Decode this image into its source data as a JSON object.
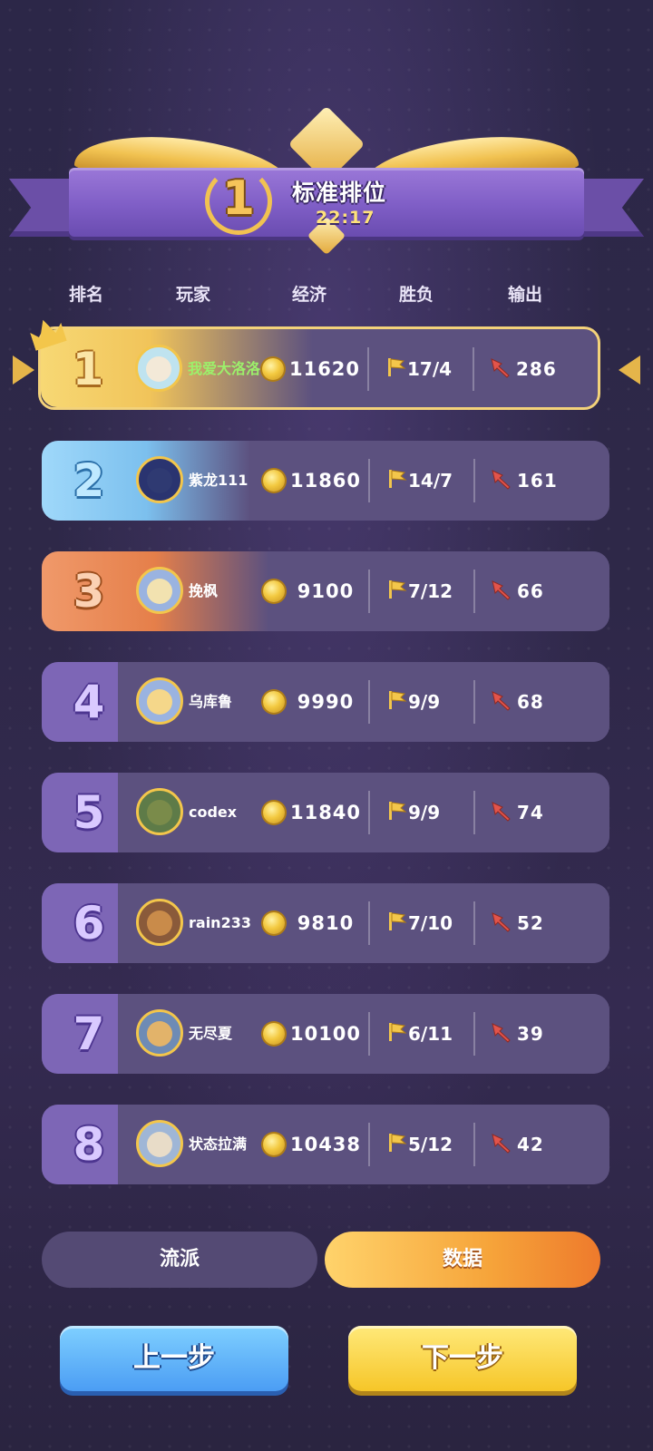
{
  "header": {
    "rank": "1",
    "title": "标准排位",
    "time": "22:17"
  },
  "columns": [
    "排名",
    "玩家",
    "经济",
    "胜负",
    "输出"
  ],
  "players": [
    {
      "rank": "1",
      "name": "我爱大洛洛",
      "gold": "11620",
      "win_loss": "17/4",
      "damage": "286"
    },
    {
      "rank": "2",
      "name": "紫龙111",
      "gold": "11860",
      "win_loss": "14/7",
      "damage": "161"
    },
    {
      "rank": "3",
      "name": "挽枫",
      "gold": "9100",
      "win_loss": "7/12",
      "damage": "66"
    },
    {
      "rank": "4",
      "name": "乌库鲁",
      "gold": "9990",
      "win_loss": "9/9",
      "damage": "68"
    },
    {
      "rank": "5",
      "name": "codex",
      "gold": "11840",
      "win_loss": "9/9",
      "damage": "74"
    },
    {
      "rank": "6",
      "name": "rain233",
      "gold": "9810",
      "win_loss": "7/10",
      "damage": "52"
    },
    {
      "rank": "7",
      "name": "无尽夏",
      "gold": "10100",
      "win_loss": "6/11",
      "damage": "39"
    },
    {
      "rank": "8",
      "name": "状态拉满",
      "gold": "10438",
      "win_loss": "5/12",
      "damage": "42"
    }
  ],
  "tabs": {
    "left": "流派",
    "right": "数据"
  },
  "buttons": {
    "prev": "上一步",
    "next": "下一步"
  },
  "colors": {
    "rank1": "#f5d36b",
    "rank2": "#8fd0f5",
    "rank3": "#e98a52",
    "rank_other": "#7f67b8",
    "highlight_name": "#9cf06b",
    "coin": "#f3c940"
  }
}
